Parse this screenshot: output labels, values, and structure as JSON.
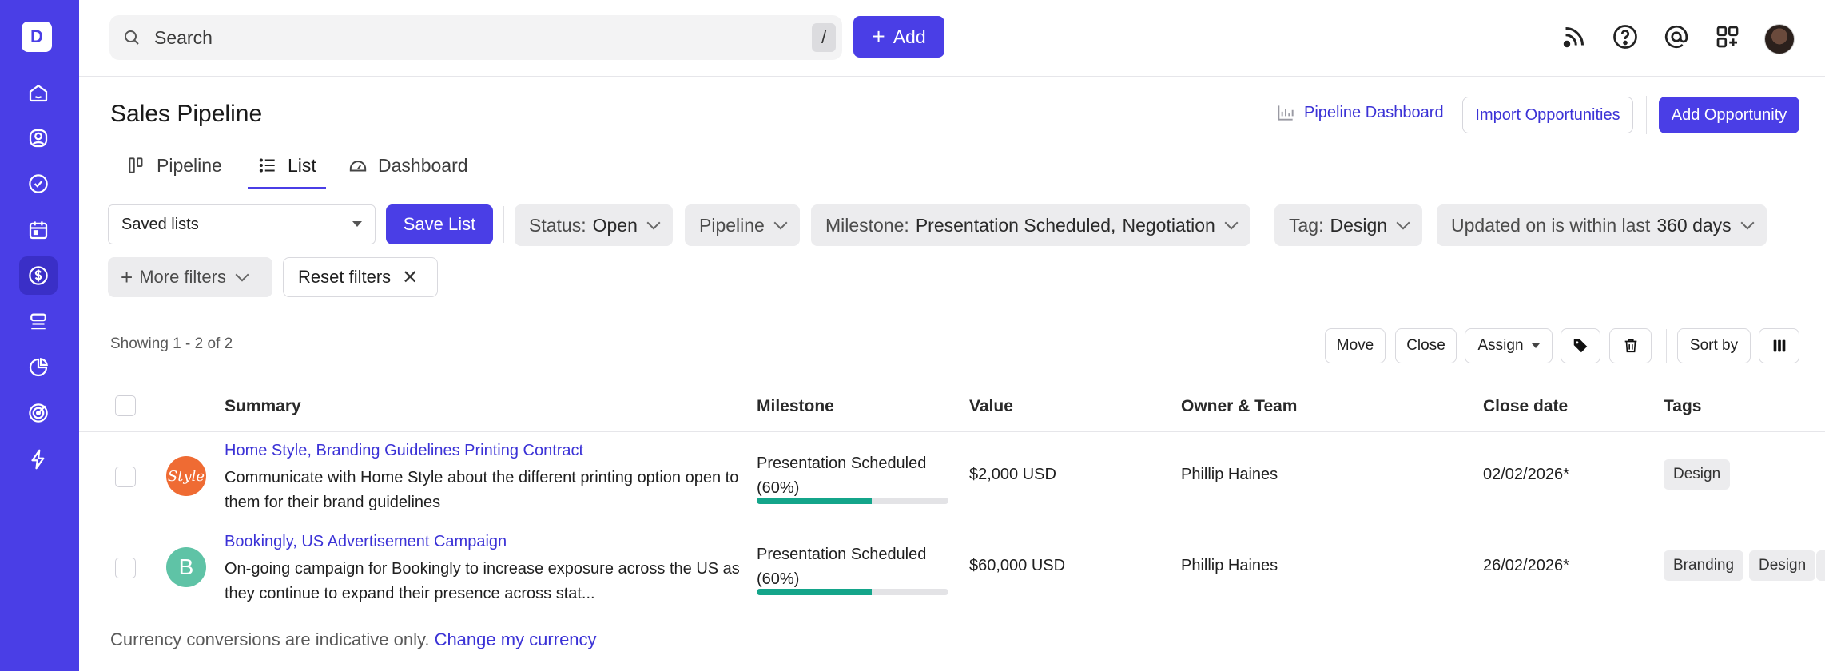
{
  "sidebar": {
    "brand_letter": "D",
    "items": [
      {
        "name": "home",
        "icon": "home-icon"
      },
      {
        "name": "contacts",
        "icon": "user-circle-icon"
      },
      {
        "name": "tasks",
        "icon": "check-circle-icon"
      },
      {
        "name": "calendar",
        "icon": "calendar-icon"
      },
      {
        "name": "sales",
        "icon": "dollar-icon",
        "active": true
      },
      {
        "name": "projects",
        "icon": "stack-icon"
      },
      {
        "name": "reports",
        "icon": "pie-chart-icon"
      },
      {
        "name": "goals",
        "icon": "target-icon"
      },
      {
        "name": "automations",
        "icon": "lightning-icon"
      }
    ],
    "accent": "#4a3ee6"
  },
  "topbar": {
    "search_placeholder": "Search",
    "search_shortcut": "/",
    "add_label": "Add",
    "icons": [
      "feed-icon",
      "help-icon",
      "mention-icon",
      "apps-icon",
      "avatar"
    ]
  },
  "page": {
    "title": "Sales Pipeline",
    "pipeline_dashboard_link": "Pipeline Dashboard",
    "import_label": "Import Opportunities",
    "add_opportunity_label": "Add Opportunity"
  },
  "tabs": [
    {
      "label": "Pipeline",
      "icon": "board-icon"
    },
    {
      "label": "List",
      "icon": "list-icon",
      "active": true
    },
    {
      "label": "Dashboard",
      "icon": "gauge-icon"
    }
  ],
  "filters": {
    "saved_lists_value": "Saved lists",
    "save_list_label": "Save List",
    "status": {
      "label": "Status:",
      "value": "Open"
    },
    "pipeline": {
      "label": "Pipeline"
    },
    "milestone": {
      "label": "Milestone:",
      "value1": "Presentation Scheduled,",
      "value2": "Negotiation"
    },
    "tag": {
      "label": "Tag:",
      "value": "Design"
    },
    "updated": {
      "label": "Updated on is within last",
      "value": "360 days"
    },
    "more_filters_label": "More filters",
    "reset_filters_label": "Reset filters"
  },
  "toolbar": {
    "showing": "Showing 1 - 2 of 2",
    "move": "Move",
    "close": "Close",
    "assign": "Assign",
    "sort_by": "Sort by"
  },
  "table": {
    "headers": {
      "summary": "Summary",
      "milestone": "Milestone",
      "value": "Value",
      "owner": "Owner & Team",
      "close_date": "Close date",
      "tags": "Tags"
    },
    "rows": [
      {
        "logo_text": "Style",
        "title": "Home Style, Branding Guidelines Printing Contract",
        "description": "Communicate with Home Style about the different printing option open to them for their brand guidelines",
        "milestone": "Presentation Scheduled (60%)",
        "progress": 0.6,
        "value": "$2,000 USD",
        "owner": "Phillip Haines",
        "close_date": "02/02/2026*",
        "tags": [
          "Design"
        ]
      },
      {
        "logo_text": "B",
        "title": "Bookingly, US Advertisement Campaign",
        "description": "On-going campaign for Bookingly to increase exposure across the US as they continue to expand their presence across stat...",
        "milestone": "Presentation Scheduled (60%)",
        "progress": 0.6,
        "value": "$60,000 USD",
        "owner": "Phillip Haines",
        "close_date": "26/02/2026*",
        "tags": [
          "Branding",
          "Design"
        ]
      }
    ]
  },
  "footer": {
    "note": "Currency conversions are indicative only.",
    "link": "Change my currency"
  }
}
